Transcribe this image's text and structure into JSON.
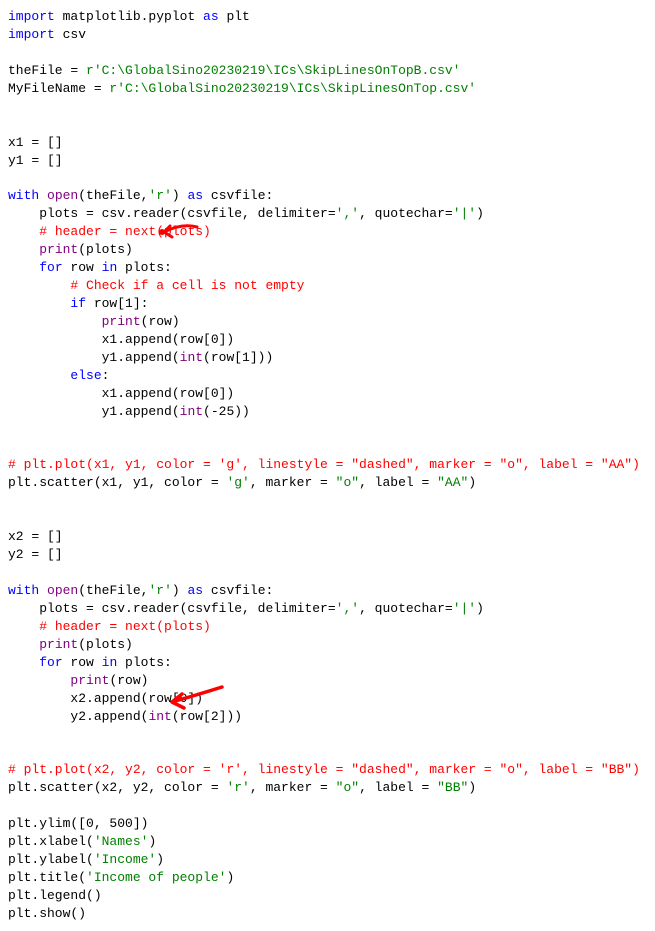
{
  "code": {
    "l1a": "import",
    "l1b": " matplotlib.pyplot ",
    "l1c": "as",
    "l1d": " plt",
    "l2a": "import",
    "l2b": " csv",
    "l3": "",
    "l4a": "theFile = ",
    "l4b": "r'C:\\GlobalSino20230219\\ICs\\SkipLinesOnTopB.csv'",
    "l5a": "MyFileName = ",
    "l5b": "r'C:\\GlobalSino20230219\\ICs\\SkipLinesOnTop.csv'",
    "l6": "",
    "l7": "",
    "l8": "x1 = []",
    "l9": "y1 = []",
    "l10": "",
    "l11a": "with",
    "l11b": " ",
    "l11c": "open",
    "l11d": "(theFile,",
    "l11e": "'r'",
    "l11f": ") ",
    "l11g": "as",
    "l11h": " csvfile:",
    "l12a": "    plots = csv.reader(csvfile, delimiter=",
    "l12b": "','",
    "l12c": ", quotechar=",
    "l12d": "'|'",
    "l12e": ")",
    "l13a": "    ",
    "l13b": "# header = next(plots)",
    "l14a": "    ",
    "l14b": "print",
    "l14c": "(plots)",
    "l15a": "    ",
    "l15b": "for",
    "l15c": " row ",
    "l15d": "in",
    "l15e": " plots:",
    "l16a": "        ",
    "l16b": "# Check if a cell is not empty",
    "l17a": "        ",
    "l17b": "if",
    "l17c": " row[1]:",
    "l18a": "            ",
    "l18b": "print",
    "l18c": "(row)",
    "l19a": "            x1.append(row[0])",
    "l20a": "            y1.append(",
    "l20b": "int",
    "l20c": "(row[1]))",
    "l21a": "        ",
    "l21b": "else",
    "l21c": ":",
    "l22a": "            x1.append(row[0])",
    "l23a": "            y1.append(",
    "l23b": "int",
    "l23c": "(-25))",
    "l24": "",
    "l25": "",
    "l26a": "# plt.plot(x1, y1, color = 'g', linestyle = \"dashed\", marker = \"o\", label = \"AA\")",
    "l27a": "plt.scatter(x1, y1, color = ",
    "l27b": "'g'",
    "l27c": ", marker = ",
    "l27d": "\"o\"",
    "l27e": ", label = ",
    "l27f": "\"AA\"",
    "l27g": ")",
    "l28": "",
    "l29": "",
    "l30": "x2 = []",
    "l31": "y2 = []",
    "l32": "",
    "l33a": "with",
    "l33b": " ",
    "l33c": "open",
    "l33d": "(theFile,",
    "l33e": "'r'",
    "l33f": ") ",
    "l33g": "as",
    "l33h": " csvfile:",
    "l34a": "    plots = csv.reader(csvfile, delimiter=",
    "l34b": "','",
    "l34c": ", quotechar=",
    "l34d": "'|'",
    "l34e": ")",
    "l35a": "    ",
    "l35b": "# header = next(plots)",
    "l36a": "    ",
    "l36b": "print",
    "l36c": "(plots)",
    "l37a": "    ",
    "l37b": "for",
    "l37c": " row ",
    "l37d": "in",
    "l37e": " plots:",
    "l38a": "        ",
    "l38b": "print",
    "l38c": "(row)",
    "l39a": "        x2.append(row[0])",
    "l40a": "        y2.append(",
    "l40b": "int",
    "l40c": "(row[2]))",
    "l41": "",
    "l42": "",
    "l43a": "# plt.plot(x2, y2, color = 'r', linestyle = \"dashed\", marker = \"o\", label = \"BB\")",
    "l44a": "plt.scatter(x2, y2, color = ",
    "l44b": "'r'",
    "l44c": ", marker = ",
    "l44d": "\"o\"",
    "l44e": ", label = ",
    "l44f": "\"BB\"",
    "l44g": ")",
    "l45": "",
    "l46a": "plt.ylim([0, 500])",
    "l47a": "plt.xlabel(",
    "l47b": "'Names'",
    "l47c": ")",
    "l48a": "plt.ylabel(",
    "l48b": "'Income'",
    "l48c": ")",
    "l49a": "plt.title(",
    "l49b": "'Income of people'",
    "l49c": ")",
    "l50": "plt.legend()",
    "l51": "plt.show()"
  }
}
